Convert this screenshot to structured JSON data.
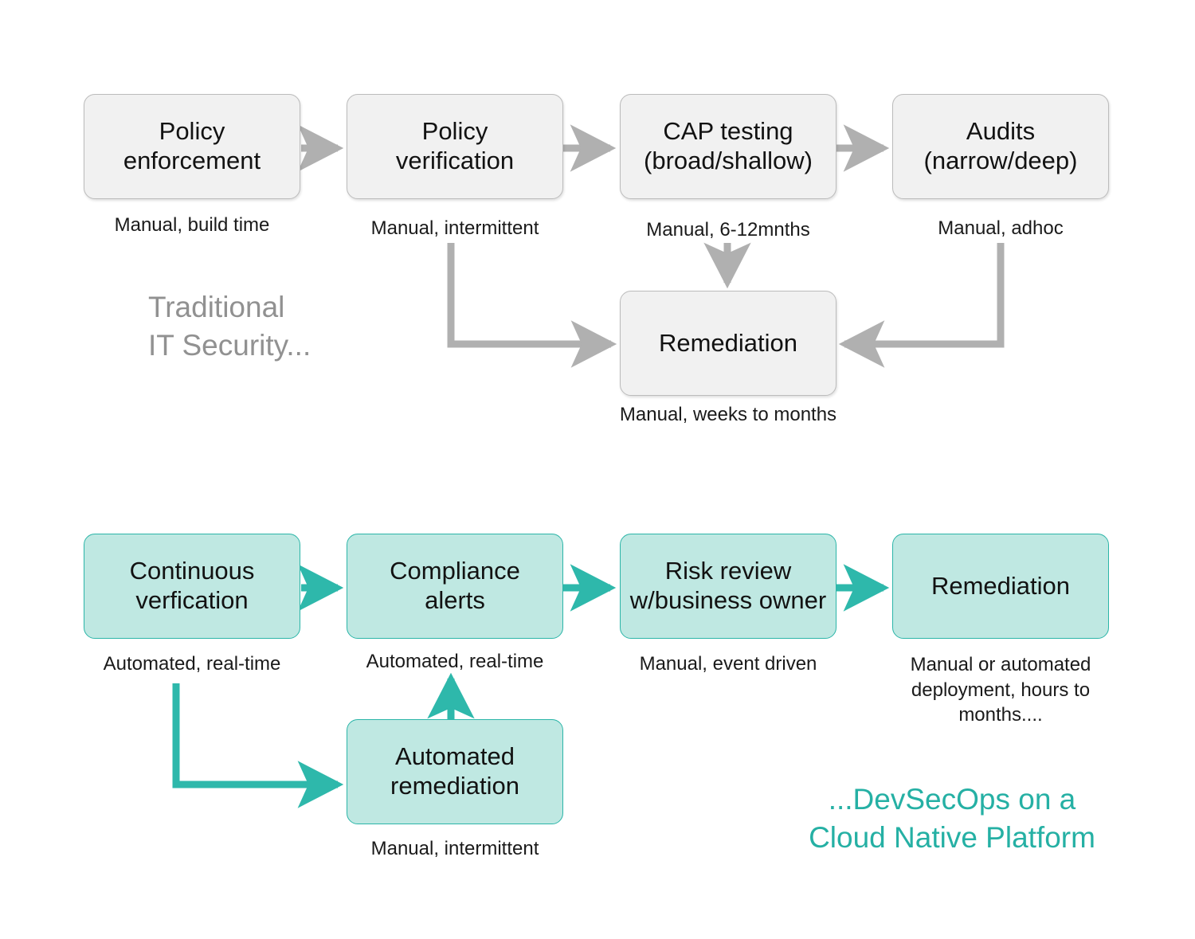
{
  "colors": {
    "gray_fill": "#f1f1f1",
    "gray_border": "#bcbcbc",
    "gray_arrow": "#b0b0b0",
    "gray_text": "#919191",
    "teal_fill": "#bfe8e2",
    "teal_border": "#2bb5a8",
    "teal_arrow": "#2eb8ab",
    "teal_text": "#25b0a4",
    "node_text": "#121212",
    "background": "#ffffff"
  },
  "traditional": {
    "section_label": "Traditional\nIT Security...",
    "nodes": [
      {
        "id": "policy-enforcement",
        "label": "Policy\nenforcement",
        "caption": "Manual, build time"
      },
      {
        "id": "policy-verification",
        "label": "Policy\nverification",
        "caption": "Manual, intermittent"
      },
      {
        "id": "cap-testing",
        "label": "CAP testing\n(broad/shallow)",
        "caption": "Manual, 6-12mnths"
      },
      {
        "id": "audits",
        "label": "Audits\n(narrow/deep)",
        "caption": "Manual, adhoc"
      },
      {
        "id": "remediation",
        "label": "Remediation",
        "caption": "Manual, weeks to months"
      }
    ]
  },
  "devsecops": {
    "section_label": "...DevSecOps on a\nCloud Native Platform",
    "nodes": [
      {
        "id": "continuous-verfication",
        "label": "Continuous\nverfication",
        "caption": "Automated, real-time"
      },
      {
        "id": "compliance-alerts",
        "label": "Compliance\nalerts",
        "caption": "Automated, real-time"
      },
      {
        "id": "risk-review",
        "label": "Risk review\nw/business owner",
        "caption": "Manual, event driven"
      },
      {
        "id": "remediation",
        "label": "Remediation",
        "caption": "Manual or automated\ndeployment, hours to\nmonths...."
      },
      {
        "id": "automated-remediation",
        "label": "Automated\nremediation",
        "caption": "Manual, intermittent"
      }
    ]
  }
}
